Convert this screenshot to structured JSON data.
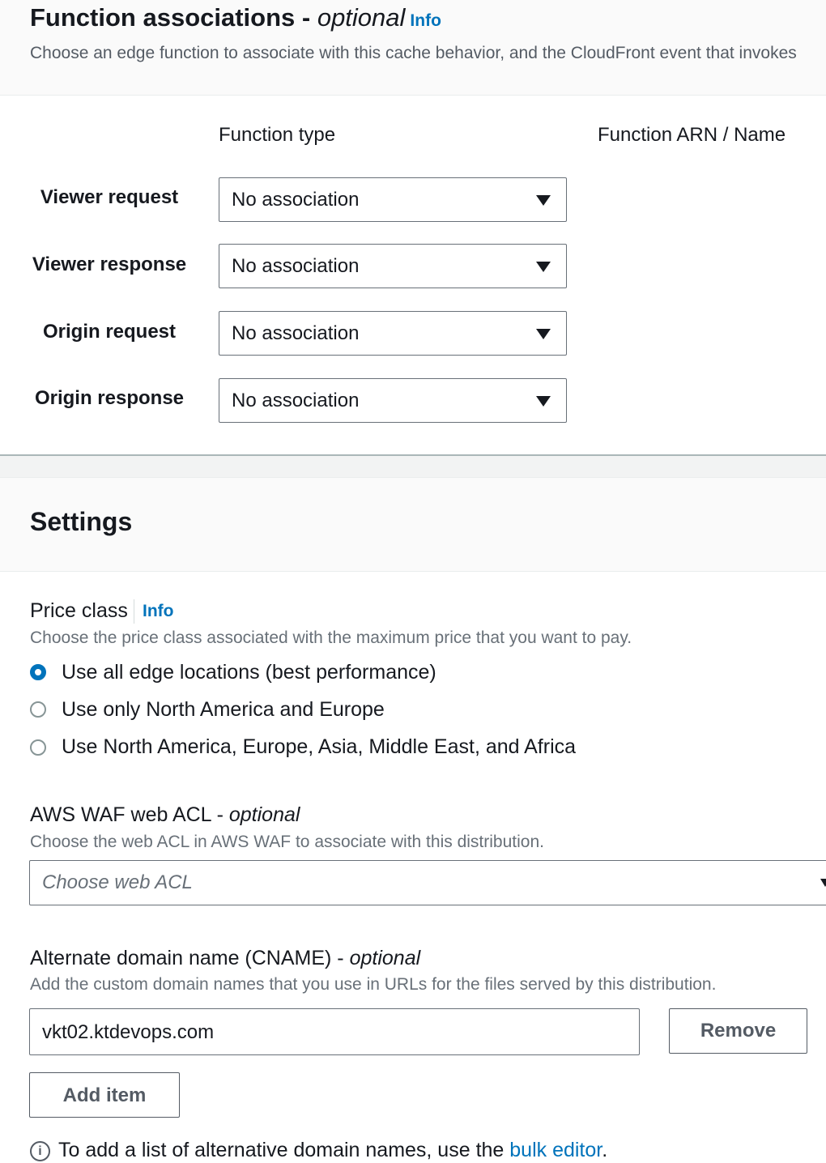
{
  "function_associations": {
    "title": "Function associations - ",
    "title_optional": "optional",
    "info_label": "Info",
    "description": "Choose an edge function to associate with this cache behavior, and the CloudFront event that invokes",
    "col_function_type": "Function type",
    "col_function_arn": "Function ARN / Name",
    "rows": [
      {
        "label": "Viewer request",
        "value": "No association"
      },
      {
        "label": "Viewer response",
        "value": "No association"
      },
      {
        "label": "Origin request",
        "value": "No association"
      },
      {
        "label": "Origin response",
        "value": "No association"
      }
    ]
  },
  "settings": {
    "title": "Settings",
    "price_class": {
      "label": "Price class",
      "info_label": "Info",
      "description": "Choose the price class associated with the maximum price that you want to pay.",
      "options": [
        {
          "label": "Use all edge locations (best performance)",
          "selected": true
        },
        {
          "label": "Use only North America and Europe",
          "selected": false
        },
        {
          "label": "Use North America, Europe, Asia, Middle East, and Africa",
          "selected": false
        }
      ]
    },
    "waf": {
      "label": "AWS WAF web ACL - ",
      "label_optional": "optional",
      "description": "Choose the web ACL in AWS WAF to associate with this distribution.",
      "placeholder": "Choose web ACL"
    },
    "cname": {
      "label": "Alternate domain name (CNAME) - ",
      "label_optional": "optional",
      "description": "Add the custom domain names that you use in URLs for the files served by this distribution.",
      "value": "vkt02.ktdevops.com",
      "remove_label": "Remove",
      "add_label": "Add item"
    },
    "footer": {
      "info_glyph": "i",
      "text": "To add a list of alternative domain names, use the ",
      "link_text": "bulk editor",
      "suffix": "."
    }
  },
  "colors": {
    "accent": "#0073bb",
    "text": "#16191f",
    "muted": "#687078"
  }
}
